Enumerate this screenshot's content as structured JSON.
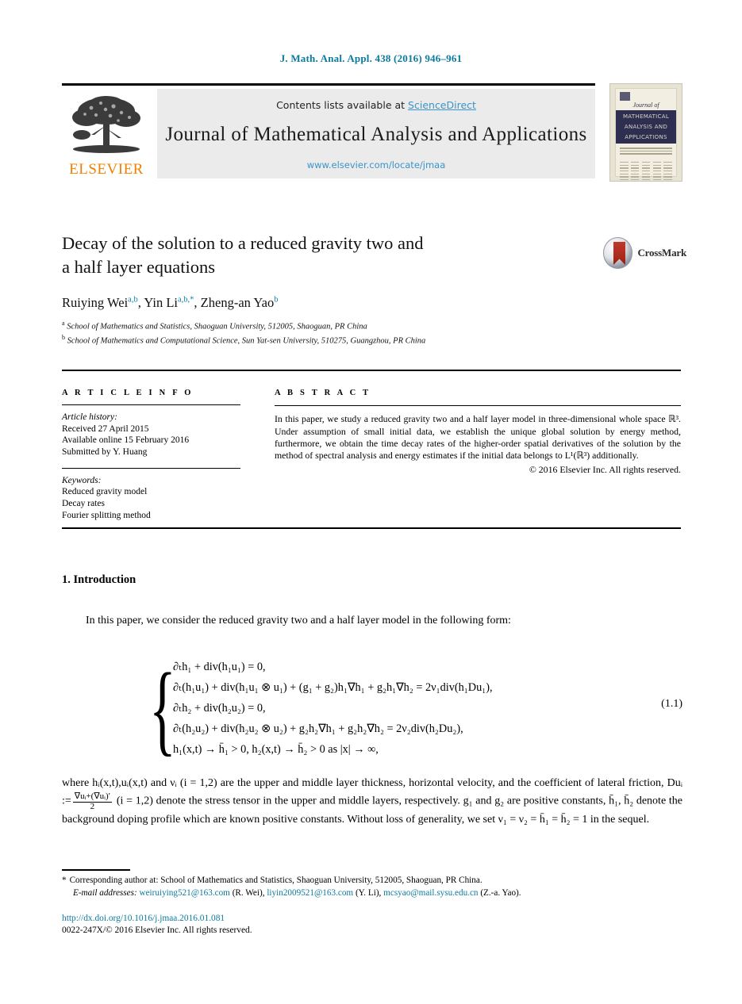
{
  "running_head": "J. Math. Anal. Appl. 438 (2016) 946–961",
  "masthead": {
    "contents_prefix": "Contents lists available at ",
    "sciencedirect": "ScienceDirect",
    "journal_title": "Journal of Mathematical Analysis and Applications",
    "journal_url": "www.elsevier.com/locate/jmaa",
    "publisher": "ELSEVIER",
    "publisher_logo_icon": "elsevier-tree-icon",
    "cover": {
      "journal_of": "Journal of",
      "band_line1": "MATHEMATICAL",
      "band_line2": "ANALYSIS AND",
      "band_line3": "APPLICATIONS"
    },
    "accent_link_color": "#3a94c9",
    "brand_orange": "#f08000"
  },
  "article": {
    "title_line1": "Decay of the solution to a reduced gravity two and",
    "title_line2": "a half layer equations",
    "crossmark_label": "CrossMark",
    "crossmark_icon": "crossmark-badge-icon",
    "authors": [
      {
        "name": "Ruiying Wei",
        "marks": "a,b"
      },
      {
        "name": "Yin Li",
        "marks": "a,b,*"
      },
      {
        "name": "Zheng-an Yao",
        "marks": "b"
      }
    ],
    "affiliations": [
      {
        "mark": "a",
        "text": "School of Mathematics and Statistics, Shaoguan University, 512005, Shaoguan, PR China"
      },
      {
        "mark": "b",
        "text": "School of Mathematics and Computational Science, Sun Yat-sen University, 510275, Guangzhou, PR China"
      }
    ]
  },
  "info": {
    "heading": "A R T I C L E   I N F O",
    "history_label": "Article history:",
    "history": [
      "Received 27 April 2015",
      "Available online 15 February 2016",
      "Submitted by Y. Huang"
    ],
    "keywords_label": "Keywords:",
    "keywords": [
      "Reduced gravity model",
      "Decay rates",
      "Fourier splitting method"
    ]
  },
  "abstract": {
    "heading": "A B S T R A C T",
    "text": "In this paper, we study a reduced gravity two and a half layer model in three-dimensional whole space ℝ³. Under assumption of small initial data, we establish the unique global solution by energy method, furthermore, we obtain the time decay rates of the higher-order spatial derivatives of the solution by the method of spectral analysis and energy estimates if the initial data belongs to L¹(ℝ³) additionally.",
    "copyright": "© 2016 Elsevier Inc. All rights reserved."
  },
  "body": {
    "section_heading": "1. Introduction",
    "paragraph1": "In this paper, we consider the reduced gravity two and a half layer model in the following form:",
    "equation_number": "(1.1)",
    "equation_lines": [
      "∂ₜh₁ + div(h₁u₁) = 0,",
      "∂ₜ(h₁u₁) + div(h₁u₁ ⊗ u₁) + (g₁ + g₂)h₁∇h₁ + g₂h₁∇h₂ = 2ν₁div(h₁Du₁),",
      "∂ₜh₂ + div(h₂u₂) = 0,",
      "∂ₜ(h₂u₂) + div(h₂u₂ ⊗ u₂) + g₂h₂∇h₁ + g₂h₂∇h₂ = 2ν₂div(h₂Du₂),",
      "h₁(x,t) → h̄₁ > 0, h₂(x,t) → h̄₂ > 0 as |x| → ∞,"
    ],
    "paragraph2_a": "where hᵢ(x,t),uᵢ(x,t) and νᵢ (i = 1,2) are the upper and middle layer thickness, horizontal velocity, and the coefficient of lateral friction, Duᵢ :=",
    "paragraph2_frac_num": "∇uᵢ+(∇uᵢ)′",
    "paragraph2_frac_den": "2",
    "paragraph2_b": "(i = 1,2) denote the stress tensor in the upper and middle layers, respectively. g₁ and g₂ are positive constants, h̄₁, h̄₂ denote the background doping profile which are known positive constants. Without loss of generality, we set ν₁ = ν₂ = h̄₁ = h̄₂ = 1 in the sequel."
  },
  "footnotes": {
    "corresponding_marker": "*",
    "corresponding": "Corresponding author at: School of Mathematics and Statistics, Shaoguan University, 512005, Shaoguan, PR China.",
    "email_label": "E-mail addresses:",
    "emails": [
      {
        "address": "weiruiying521@163.com",
        "owner": "(R. Wei),"
      },
      {
        "address": "liyin2009521@163.com",
        "owner": "(Y. Li),"
      },
      {
        "address": "mcsyao@mail.sysu.edu.cn",
        "owner": "(Z.-a. Yao)."
      }
    ],
    "doi": "http://dx.doi.org/10.1016/j.jmaa.2016.01.081",
    "issn_line": "0022-247X/© 2016 Elsevier Inc. All rights reserved."
  }
}
